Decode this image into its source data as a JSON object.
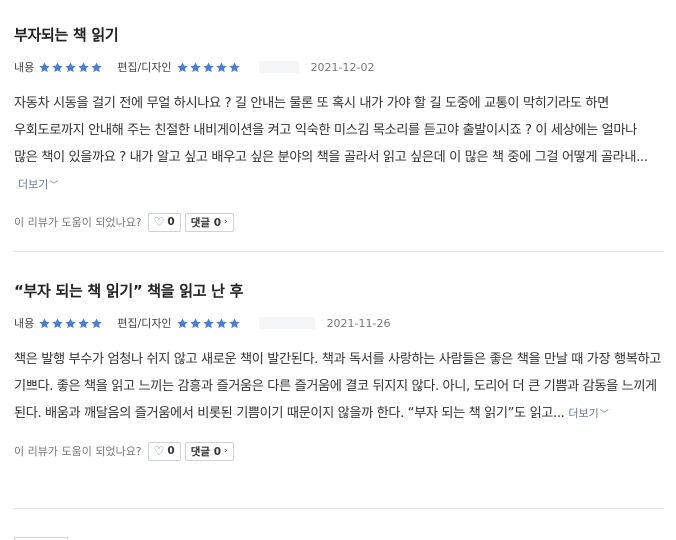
{
  "reviews": [
    {
      "title": "부자되는 책 읽기",
      "content_label": "내용",
      "content_rating": 5,
      "design_label": "편집/디자인",
      "design_rating": 5,
      "date": "2021-12-02",
      "body": "자동차 시동을 걸기 전에 무얼 하시나요 ? 길 안내는 물론 또 혹시 내가 가야 할 길 도중에 교통이 막히기라도 하면 우회도로까지 안내해 주는 친절한 내비게이션을 켜고 익숙한 미스김 목소리를 듣고야 출발이시죠 ? 이 세상에는 얼마나 많은 책이 있을까요 ? 내가 알고 싶고 배우고 싶은 분야의 책을 골라서 읽고 싶은데 이 많은 책 중에 그걸 어떻게 골라내...",
      "more_label": "더보기",
      "helpful_question": "이 리뷰가 도움이 되었나요?",
      "like_count": "0",
      "comment_label": "댓글 0"
    },
    {
      "title": "“부자 되는 책 읽기” 책을 읽고 난 후",
      "content_label": "내용",
      "content_rating": 5,
      "design_label": "편집/디자인",
      "design_rating": 5,
      "date": "2021-11-26",
      "body": "책은 발행 부수가 엄청나 쉬지 않고 새로운 책이 발간된다. 책과 독서를 사랑하는 사람들은 좋은 책을 만날 때 가장 행복하고 기쁘다. 좋은 책을 읽고 느끼는 감흥과 즐거움은 다른 즐거움에 결코 뒤지지 않다. 아니, 도리어 더 큰 기쁨과 감동을 느끼게 된다. 배움과 깨달음의 즐거움에서 비롯된 기쁨이기 때문이지 않을까 한다. “부자 되는 책 읽기”도 읽고...",
      "more_label": "더보기",
      "helpful_question": "이 리뷰가 도움이 되었나요?",
      "like_count": "0",
      "comment_label": "댓글 0"
    }
  ],
  "colors": {
    "star": "#4a7fd6",
    "like_heart": "#3a6fc9",
    "more_link": "#6a7d95"
  },
  "icons": {
    "star": "star-icon",
    "heart": "heart-icon",
    "chevron_down": "chevron-down-icon",
    "chevron_right": "chevron-right-icon"
  }
}
